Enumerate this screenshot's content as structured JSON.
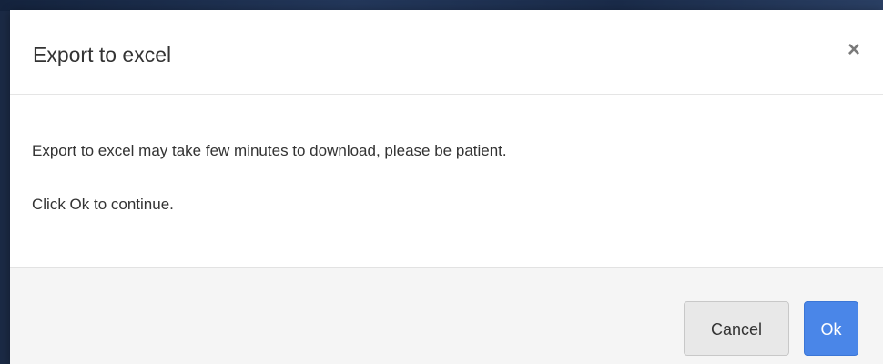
{
  "dialog": {
    "title": "Export to excel",
    "close_glyph": "×",
    "message": "Export to excel may take few minutes to download, please be patient.",
    "instruction": "Click Ok to continue.",
    "buttons": {
      "cancel_label": "Cancel",
      "ok_label": "Ok"
    }
  },
  "colors": {
    "primary_button": "#4a86e8",
    "backdrop": "#1b2a45"
  },
  "icons": {
    "close": "close-icon"
  }
}
